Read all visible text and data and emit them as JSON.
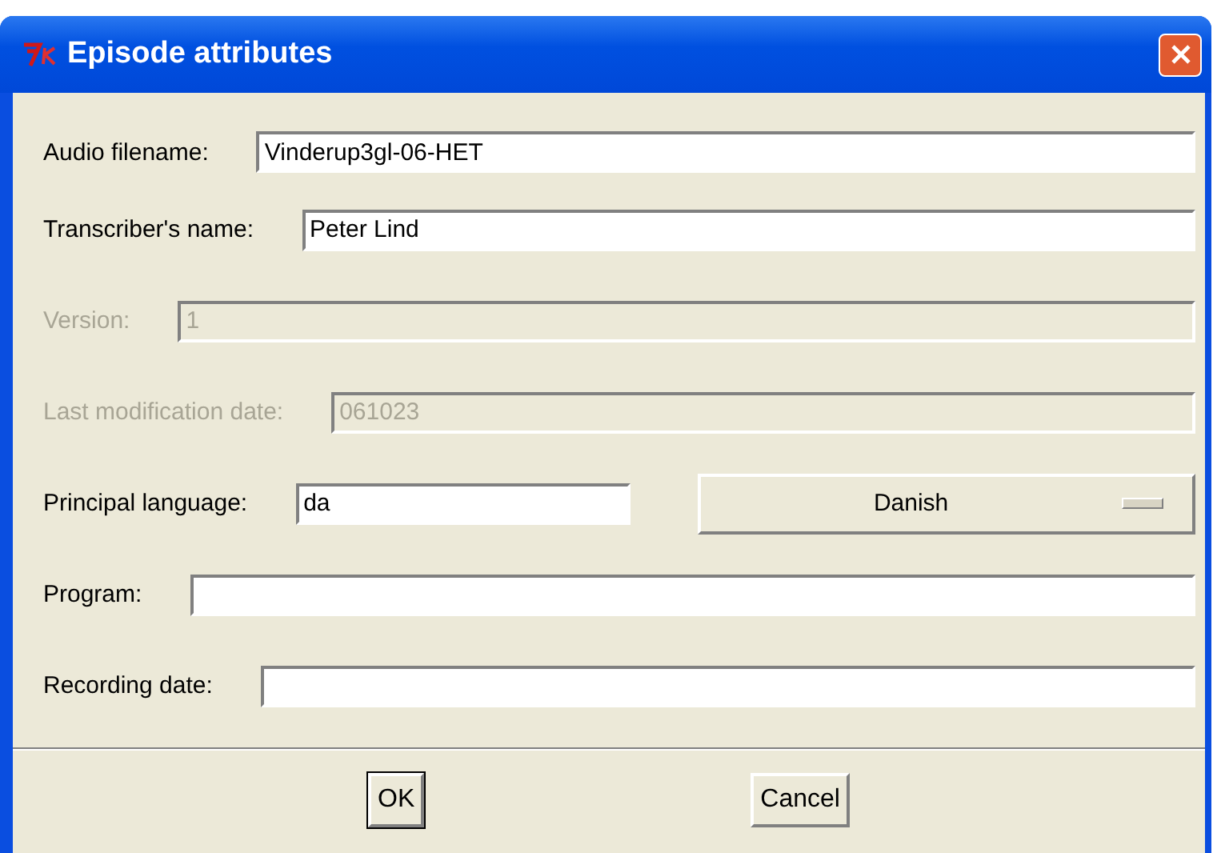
{
  "window": {
    "title": "Episode attributes"
  },
  "fields": [
    {
      "kind": "text",
      "label": "Audio filename:",
      "value": "Vinderup3gl-06-HET",
      "disabled": false
    },
    {
      "kind": "text",
      "label": "Transcriber's name:",
      "value": "Peter Lind",
      "disabled": false
    },
    {
      "kind": "text",
      "label": "Version:",
      "value": "1",
      "disabled": true
    },
    {
      "kind": "text",
      "label": "Last modification date:",
      "value": "061023",
      "disabled": true
    },
    {
      "kind": "language",
      "label": "Principal language:",
      "value": "da",
      "disabled": false,
      "menu": "Danish"
    },
    {
      "kind": "text",
      "label": "Program:",
      "disabled": false
    },
    {
      "kind": "text",
      "label": "Recording date:",
      "disabled": false
    }
  ],
  "buttons": [
    "OK",
    "Cancel"
  ]
}
